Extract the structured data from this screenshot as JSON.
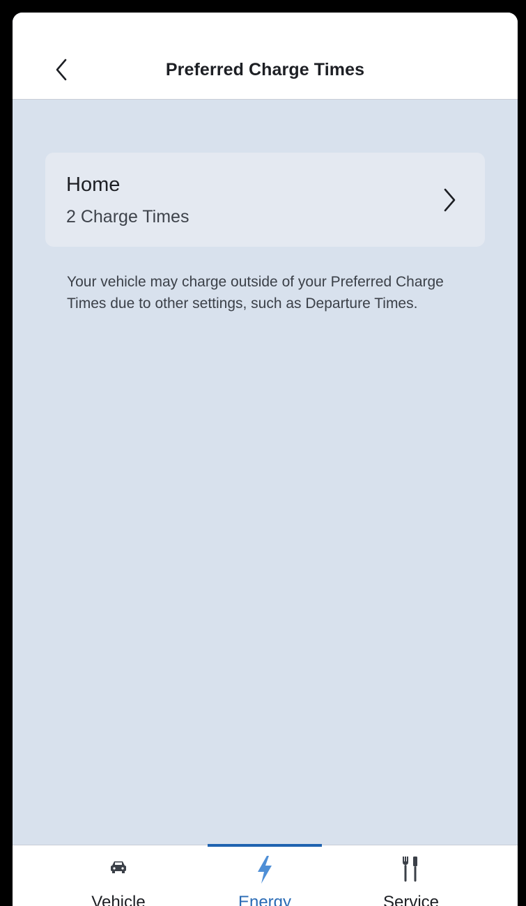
{
  "header": {
    "title": "Preferred Charge Times",
    "back_icon": "chevron-left-icon"
  },
  "location_card": {
    "name": "Home",
    "subtitle": "2 Charge Times",
    "chevron_icon": "chevron-right-icon"
  },
  "note": "Your vehicle may charge outside of your Preferred Charge Times due to other settings, such as Departure Times.",
  "tabbar": {
    "tabs": [
      {
        "label": "Vehicle",
        "icon": "car-icon",
        "active": false
      },
      {
        "label": "Energy",
        "icon": "lightning-bolt-icon",
        "active": true
      },
      {
        "label": "Service",
        "icon": "tools-icon",
        "active": false
      }
    ]
  },
  "colors": {
    "background": "#d8e1ed",
    "card": "#e4e9f1",
    "accent": "#1f63b0",
    "text": "#1d1f24"
  }
}
